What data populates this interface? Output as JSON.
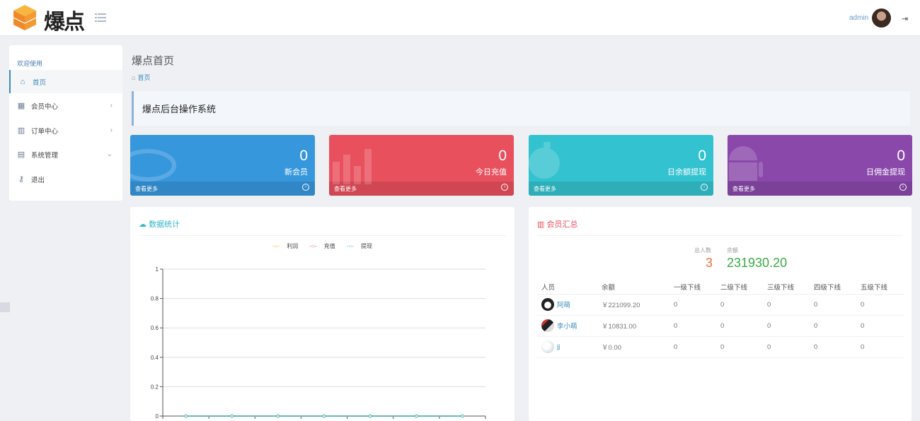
{
  "header": {
    "logo_text": "爆点",
    "admin_name": "admin",
    "icons": {
      "menu": "list-icon",
      "logout": "logout-icon"
    }
  },
  "sidebar": {
    "welcome": "欢迎使用",
    "items": [
      {
        "label": "首页",
        "icon": "home-icon",
        "active": true
      },
      {
        "label": "会员中心",
        "icon": "table-icon",
        "has_children": true
      },
      {
        "label": "订单中心",
        "icon": "bar-chart-icon",
        "has_children": true
      },
      {
        "label": "系统管理",
        "icon": "list-alt-icon",
        "has_children": true,
        "expanded": true
      },
      {
        "label": "退出",
        "icon": "key-icon"
      }
    ]
  },
  "page": {
    "title": "爆点首页",
    "breadcrumb": "首页",
    "notice": "爆点后台操作系统"
  },
  "stats": [
    {
      "value": "0",
      "label": "新会员",
      "more": "查看更多",
      "color": "#3797dd",
      "icon": "user-icon"
    },
    {
      "value": "0",
      "label": "今日充值",
      "more": "查看更多",
      "color": "#e8505d",
      "icon": "bar-chart-icon"
    },
    {
      "value": "0",
      "label": "日余额提现",
      "more": "查看更多",
      "color": "#33c2cf",
      "icon": "apple-icon"
    },
    {
      "value": "0",
      "label": "日佣金提现",
      "more": "查看更多",
      "color": "#8a48aa",
      "icon": "android-icon"
    }
  ],
  "data_panel": {
    "title": "数据统计",
    "title_color": "#33b6c9",
    "legend": [
      {
        "name": "利润",
        "color": "#f0c030"
      },
      {
        "name": "充值",
        "color": "#e06070"
      },
      {
        "name": "提现",
        "color": "#40c0c8"
      }
    ]
  },
  "chart_data": {
    "type": "line",
    "x": [
      "",
      "",
      "",
      "",
      "",
      "",
      ""
    ],
    "yticks": [
      "0",
      "0.2",
      "0.4",
      "0.6",
      "0.8",
      "1"
    ],
    "ylim": [
      0,
      1
    ],
    "series": [
      {
        "name": "利润",
        "values": [
          0,
          0,
          0,
          0,
          0,
          0,
          0
        ]
      },
      {
        "name": "充值",
        "values": [
          0,
          0,
          0,
          0,
          0,
          0,
          0
        ]
      },
      {
        "name": "提现",
        "values": [
          0,
          0,
          0,
          0,
          0,
          0,
          0
        ]
      }
    ],
    "grid": true,
    "legend_position": "top-center"
  },
  "member_panel": {
    "title": "会员汇总",
    "title_color": "#e8505d",
    "total_label": "总人数",
    "total_value": "3",
    "total_color": "#e8703d",
    "balance_label": "余额",
    "balance_value": "231930.20",
    "balance_color": "#3aaa45",
    "columns": [
      "人员",
      "余额",
      "一级下线",
      "二级下线",
      "三级下线",
      "四级下线",
      "五级下线"
    ],
    "rows": [
      {
        "name": "阿萌",
        "balance": "￥221099.20",
        "l1": "0",
        "l2": "0",
        "l3": "0",
        "l4": "0",
        "l5": "0"
      },
      {
        "name": "李小萌",
        "balance": "￥10831.00",
        "l1": "0",
        "l2": "0",
        "l3": "0",
        "l4": "0",
        "l5": "0"
      },
      {
        "name": "jj",
        "balance": "￥0.00",
        "l1": "0",
        "l2": "0",
        "l3": "0",
        "l4": "0",
        "l5": "0"
      }
    ]
  }
}
